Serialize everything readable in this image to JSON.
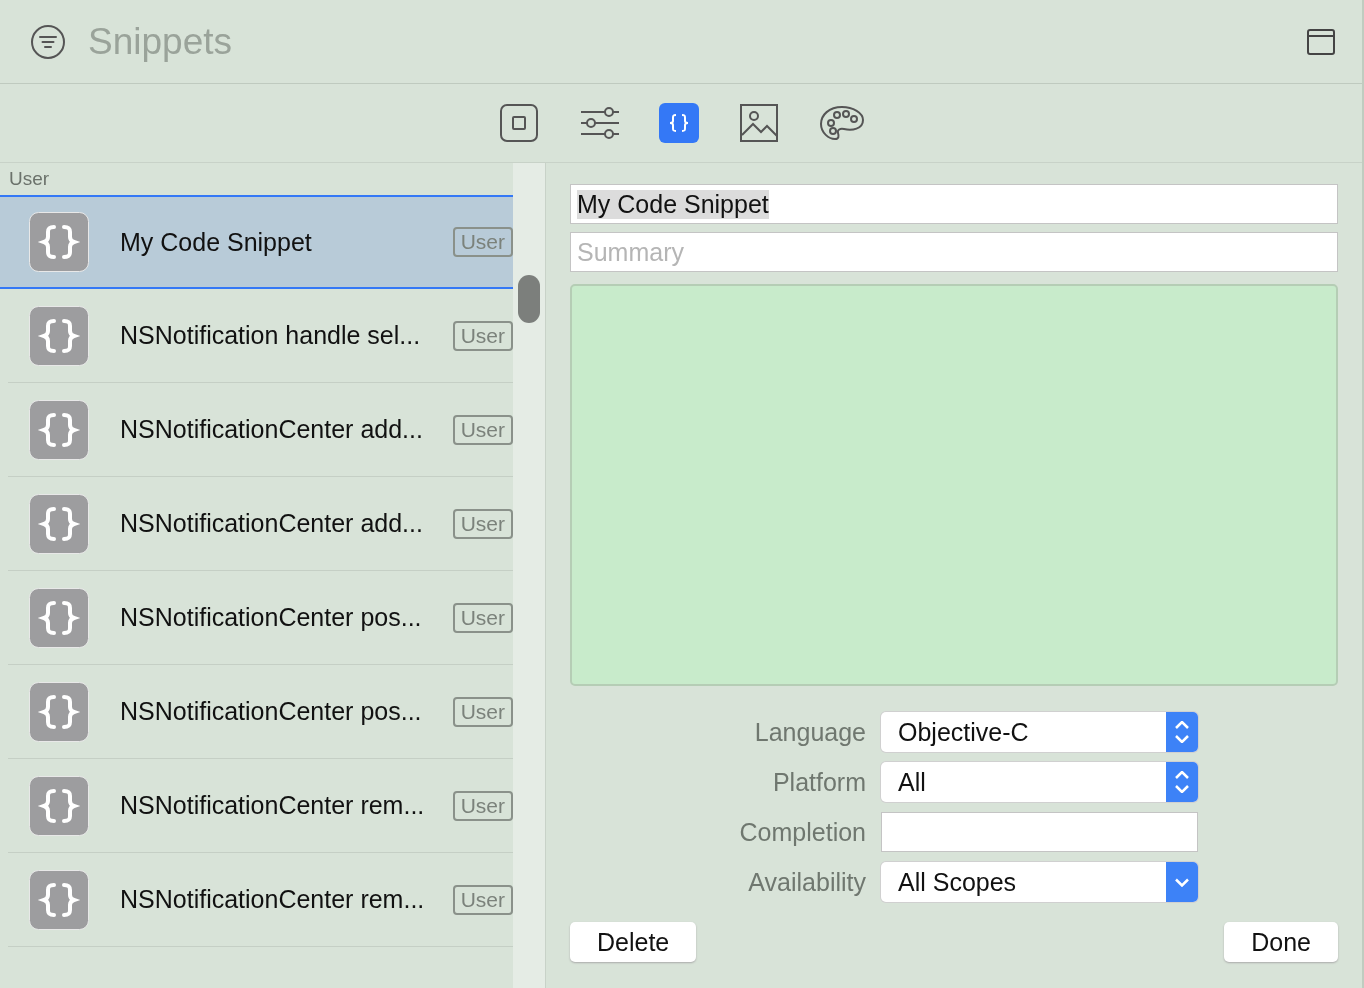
{
  "window": {
    "title": "Snippets"
  },
  "toolbar": [
    {
      "selected": false
    },
    {
      "selected": false
    },
    {
      "selected": true
    },
    {
      "selected": false
    },
    {
      "selected": false
    }
  ],
  "list": {
    "section": "User",
    "items": [
      {
        "name": "My Code Snippet",
        "badge": "User",
        "selected": true
      },
      {
        "name": "NSNotification handle sel...",
        "badge": "User",
        "selected": false
      },
      {
        "name": "NSNotificationCenter add...",
        "badge": "User",
        "selected": false
      },
      {
        "name": "NSNotificationCenter add...",
        "badge": "User",
        "selected": false
      },
      {
        "name": "NSNotificationCenter pos...",
        "badge": "User",
        "selected": false
      },
      {
        "name": "NSNotificationCenter pos...",
        "badge": "User",
        "selected": false
      },
      {
        "name": "NSNotificationCenter rem...",
        "badge": "User",
        "selected": false
      },
      {
        "name": "NSNotificationCenter rem...",
        "badge": "User",
        "selected": false
      }
    ]
  },
  "editor": {
    "title": "My Code Snippet",
    "summary_placeholder": "Summary",
    "fields": [
      {
        "label": "Language",
        "kind": "popup",
        "value": "Objective-C"
      },
      {
        "label": "Platform",
        "kind": "popup",
        "value": "All"
      },
      {
        "label": "Completion",
        "kind": "text"
      },
      {
        "label": "Availability",
        "kind": "pulldown",
        "value": "All Scopes"
      }
    ]
  },
  "buttons": {
    "delete": "Delete",
    "done": "Done"
  }
}
